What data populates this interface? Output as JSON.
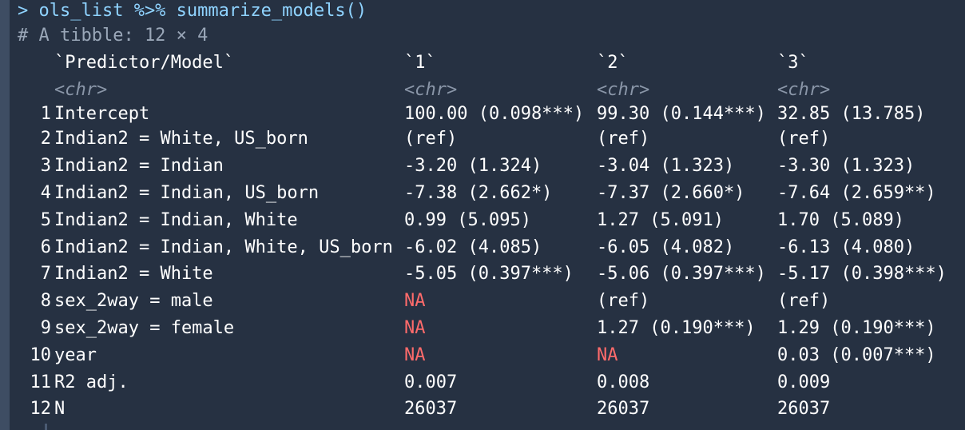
{
  "console": {
    "command": "> ols_list %>% summarize_models()",
    "comment": "# A tibble: 12 × 4",
    "na_color": "#ff6b6b",
    "columns": {
      "pred": "`Predictor/Model`",
      "m1": "`1`",
      "m2": "`2`",
      "m3": "`3`"
    },
    "types": {
      "pred": "<chr>",
      "m1": "<chr>",
      "m2": "<chr>",
      "m3": "<chr>"
    },
    "rows": [
      {
        "idx": "1",
        "pred": "Intercept",
        "m1": "100.00 (0.098***)",
        "m2": "99.30 (0.144***)",
        "m3": "32.85 (13.785)"
      },
      {
        "idx": "2",
        "pred": "Indian2 = White, US_born",
        "m1": "(ref)",
        "m2": "(ref)",
        "m3": "(ref)"
      },
      {
        "idx": "3",
        "pred": "Indian2 = Indian",
        "m1": "-3.20 (1.324)",
        "m2": "-3.04 (1.323)",
        "m3": "-3.30 (1.323)"
      },
      {
        "idx": "4",
        "pred": "Indian2 = Indian, US_born",
        "m1": "-7.38 (2.662*)",
        "m2": "-7.37 (2.660*)",
        "m3": "-7.64 (2.659**)"
      },
      {
        "idx": "5",
        "pred": "Indian2 = Indian, White",
        "m1": "0.99 (5.095)",
        "m2": "1.27 (5.091)",
        "m3": "1.70 (5.089)"
      },
      {
        "idx": "6",
        "pred": "Indian2 = Indian, White, US_born",
        "m1": "-6.02 (4.085)",
        "m2": "-6.05 (4.082)",
        "m3": "-6.13 (4.080)"
      },
      {
        "idx": "7",
        "pred": "Indian2 = White",
        "m1": "-5.05 (0.397***)",
        "m2": "-5.06 (0.397***)",
        "m3": "-5.17 (0.398***)"
      },
      {
        "idx": "8",
        "pred": "sex_2way = male",
        "m1": "NA",
        "m2": "(ref)",
        "m3": "(ref)"
      },
      {
        "idx": "9",
        "pred": "sex_2way = female",
        "m1": "NA",
        "m2": "1.27 (0.190***)",
        "m3": "1.29 (0.190***)"
      },
      {
        "idx": "10",
        "pred": "year",
        "m1": "NA",
        "m2": "NA",
        "m3": "0.03 (0.007***)"
      },
      {
        "idx": "11",
        "pred": "R2 adj.",
        "m1": "0.007",
        "m2": "0.008",
        "m3": "0.009"
      },
      {
        "idx": "12",
        "pred": "N",
        "m1": "26037",
        "m2": "26037",
        "m3": "26037"
      }
    ]
  }
}
